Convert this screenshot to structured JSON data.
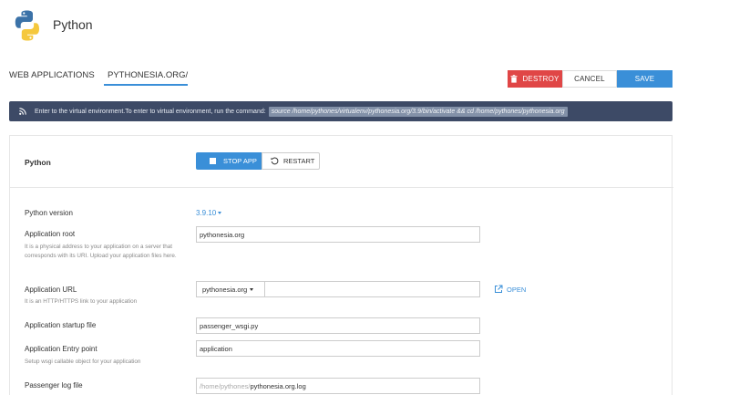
{
  "header": {
    "title": "Python",
    "logo_icon": "python-logo-icon"
  },
  "nav": {
    "tab_web_apps": "WEB APPLICATIONS",
    "tab_current": "PYTHONESIA.ORG/"
  },
  "actions": {
    "destroy": "DESTROY",
    "cancel": "CANCEL",
    "save": "SAVE"
  },
  "notice": {
    "text": "Enter to the virtual environment.To enter to virtual environment, run the command:",
    "command": "source /home/pythones/virtualenv/pythonesia.org/3.9/bin/activate && cd /home/pythones/pythonesia.org"
  },
  "app_section": {
    "title": "Python",
    "stop_label": "STOP APP",
    "restart_label": "RESTART"
  },
  "form": {
    "python_version": {
      "label": "Python version",
      "value": "3.9.10"
    },
    "app_root": {
      "label": "Application root",
      "hint": "It is a physical address to your application on a server that corresponds with its URI. Upload your application files here.",
      "value": "pythonesia.org"
    },
    "app_url": {
      "label": "Application URL",
      "hint": "It is an HTTP/HTTPS link to your application",
      "domain": "pythonesia.org",
      "path": "",
      "open_label": "OPEN"
    },
    "startup_file": {
      "label": "Application startup file",
      "value": "passenger_wsgi.py"
    },
    "entry_point": {
      "label": "Application Entry point",
      "hint": "Setup wsgi callable object for your application",
      "value": "application"
    },
    "log_file": {
      "label": "Passenger log file",
      "prefix": "/home/pythones/",
      "value": "pythonesia.org.log"
    }
  },
  "colors": {
    "accent": "#3a8fd8",
    "danger": "#e04646",
    "notice_bg": "#3d4a66"
  }
}
